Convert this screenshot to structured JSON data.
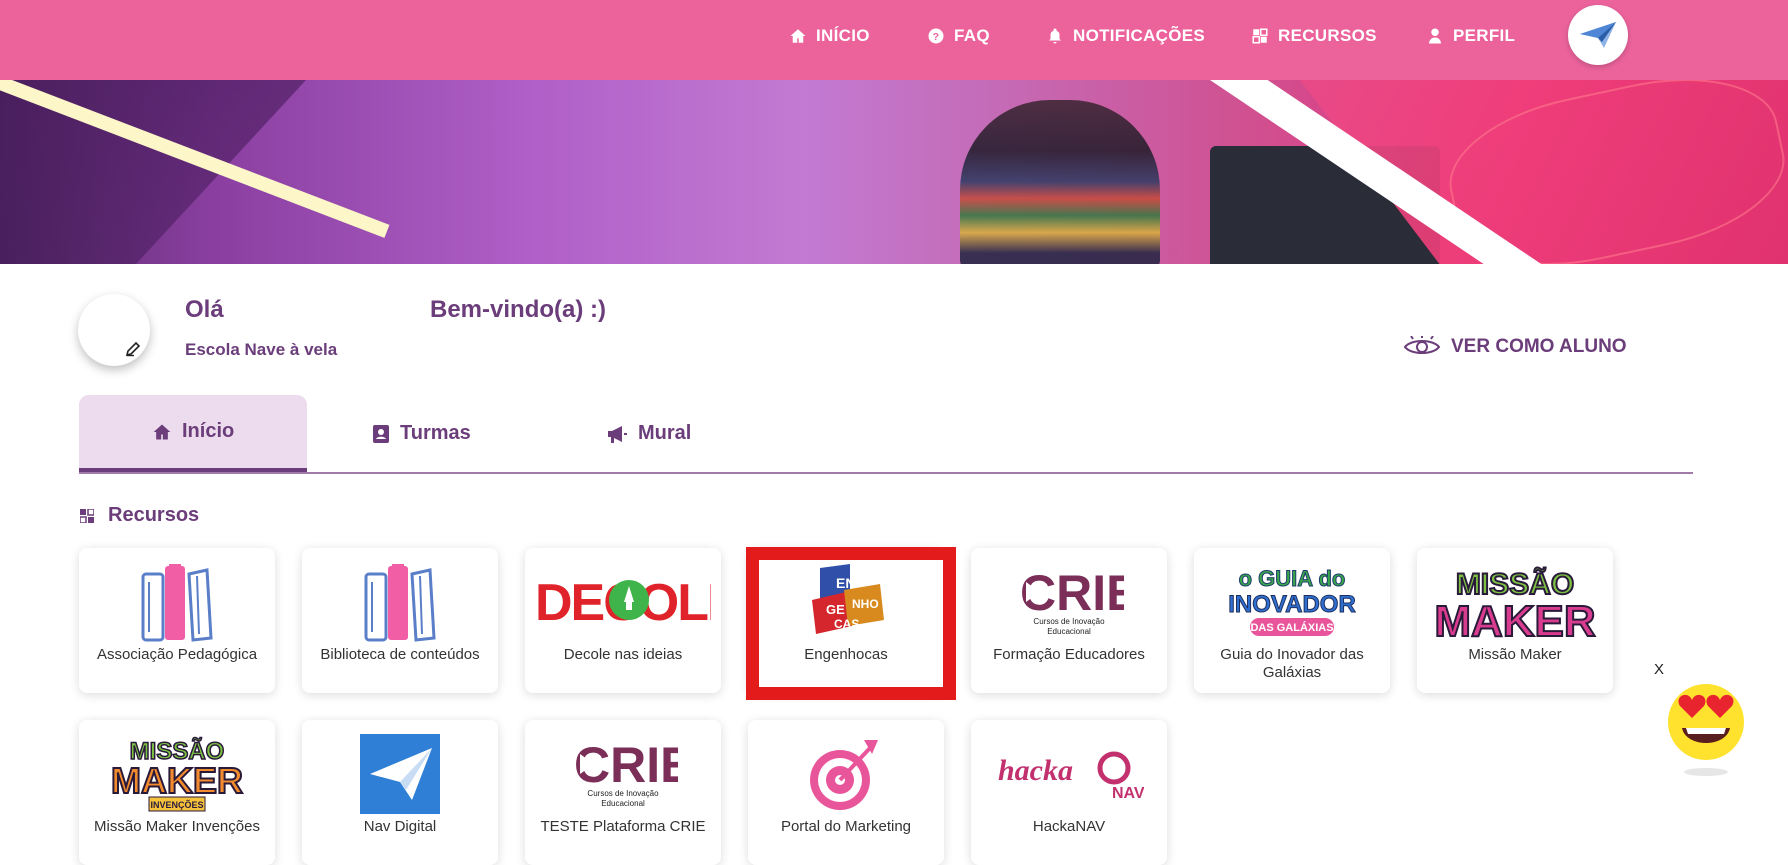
{
  "nav": {
    "inicio": "INÍCIO",
    "faq": "FAQ",
    "notificacoes": "NOTIFICAÇÕES",
    "recursos": "RECURSOS",
    "perfil": "PERFIL"
  },
  "profile": {
    "greeting_prefix": "Olá",
    "greeting_suffix": "Bem-vindo(a) :)",
    "school": "Escola Nave à vela",
    "view_as_student": "VER COMO ALUNO"
  },
  "tabs": [
    {
      "label": "Início",
      "icon": "home-icon",
      "active": true
    },
    {
      "label": "Turmas",
      "icon": "contact-book-icon",
      "active": false
    },
    {
      "label": "Mural",
      "icon": "megaphone-icon",
      "active": false
    }
  ],
  "section": {
    "title": "Recursos",
    "icon": "grid-icon"
  },
  "resources": [
    {
      "label": "Associação Pedagógica",
      "icon": "books-icon"
    },
    {
      "label": "Biblioteca de conteúdos",
      "icon": "books-icon"
    },
    {
      "label": "Decole nas ideias",
      "icon": "decole-logo",
      "logo_text": "DECOLE"
    },
    {
      "label": "Engenhocas",
      "icon": "engenhocas-logo",
      "logo_text": "ENGENHOCAS",
      "highlighted": true
    },
    {
      "label": "Formação Educadores",
      "icon": "crie-logo",
      "logo_text": "CRIE",
      "logo_sub": "Cursos de Inovação Educacional"
    },
    {
      "label": "Guia do Inovador das Galáxias",
      "icon": "guia-inovador-logo",
      "logo_text": "o GUIA do INOVADOR",
      "logo_sub": "DAS GALÁXIAS"
    },
    {
      "label": "Missão Maker",
      "icon": "missao-maker-logo",
      "logo_text": "MISSÃO MAKER"
    },
    {
      "label": "Missão Maker Invenções",
      "icon": "missao-maker-invencoes-logo",
      "logo_text": "MISSÃO MAKER",
      "logo_sub": "INVENÇÕES"
    },
    {
      "label": "Nav Digital",
      "icon": "paper-plane-icon"
    },
    {
      "label": "TESTE Plataforma CRIE",
      "icon": "crie-logo",
      "logo_text": "CRIE",
      "logo_sub": "Cursos de Inovação Educacional"
    },
    {
      "label": "Portal do Marketing",
      "icon": "target-icon"
    },
    {
      "label": "HackaNAV",
      "icon": "hackanav-logo",
      "logo_text": "hackaNAV"
    }
  ],
  "widget": {
    "close": "X",
    "icon": "heart-eyes-emoji-icon"
  },
  "colors": {
    "topbar": "#ec639c",
    "primary_text": "#6b3d7a",
    "highlight": "#e31b1b"
  }
}
